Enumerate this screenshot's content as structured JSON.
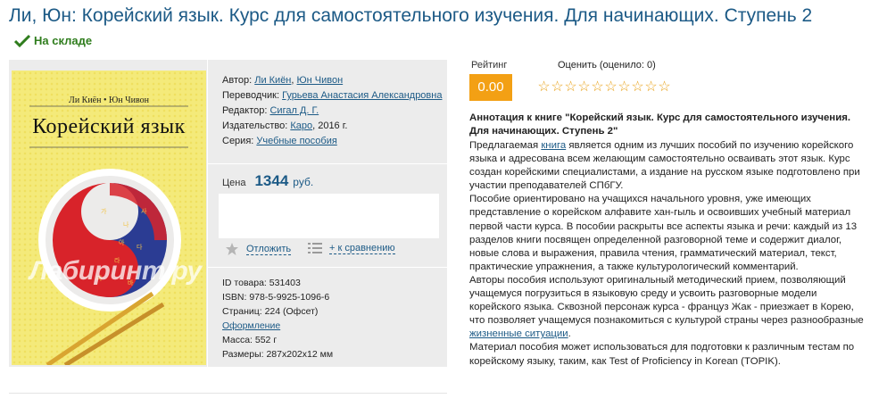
{
  "title": "Ли, Юн: Корейский язык. Курс для самостоятельного изучения. Для начинающих. Ступень 2",
  "stock_label": "На складе",
  "cover": {
    "authors": "Ли Киён • Юн Чивон",
    "title": "Корейский язык",
    "watermark": "Лабиринт.ру"
  },
  "meta": {
    "author_label": "Автор:",
    "author1": "Ли Киён",
    "author2": "Юн Чивон",
    "translator_label": "Переводчик:",
    "translator": "Гурьева Анастасия Александровна",
    "editor_label": "Редактор:",
    "editor": "Сигал Д. Г.",
    "publisher_label": "Издательство:",
    "publisher": "Каро",
    "year": ", 2016 г.",
    "series_label": "Серия:",
    "series": "Учебные пособия"
  },
  "price": {
    "label": "Цена",
    "value": "1344",
    "currency": "руб."
  },
  "actions": {
    "postpone": "Отложить",
    "compare": "+ к сравнению"
  },
  "details": {
    "id": "ID товара: 531403",
    "isbn": "ISBN: 978-5-9925-1096-6",
    "pages": "Страниц: 224 (Офсет)",
    "design": "Оформление",
    "weight": "Масса: 552 г",
    "size": "Размеры: 287x202x12 мм"
  },
  "rating": {
    "label": "Рейтинг",
    "value": "0.00",
    "rate_label": "Оценить (оценило: 0)",
    "stars": 10,
    "star_color": "#e8a21a",
    "badge_color": "#f3a014"
  },
  "annotation": {
    "heading": "Аннотация к книге \"Корейский язык. Курс для самостоятельного изучения. Для начинающих. Ступень 2\"",
    "p1_before": "Предлагаемая ",
    "p1_link": "книга",
    "p1_after": " является одним из лучших пособий по изучению корейского языка и адресована всем желающим самостоятельно осваивать этот язык. Курс создан корейскими специалистами, а издание на русском языке подготовлено при участии преподавателей СПбГУ.",
    "p2": "Пособие ориентировано на учащихся начального уровня, уже имеющих представление о корейском алфавите хан-гыль и освоивших учебный материал первой части курса. В пособии раскрыты все аспекты языка и речи: каждый из 13 разделов книги посвящен определенной разговорной теме и содержит диалог, новые слова и выражения, правила чтения, грамматический материал, текст, практические упражнения, а также культурологический комментарий.",
    "p3_before": "Авторы пособия используют оригинальный методический прием, позволяющий учащемуся погрузиться в языковую среду и усвоить разговорные модели корейского языка. Сквозной персонаж курса - француз Жак - приезжает в Корею, что позволяет учащемуся познакомиться с культурой страны через разнообразные ",
    "p3_link": "жизненные ситуации",
    "p3_after": ".",
    "p4": "Материал пособия может использоваться для подготовки к различным тестам по корейскому языку, таким, как Test of Proficiency in Korean (TOPIK)."
  },
  "colors": {
    "link": "#1c5a86",
    "stock": "#2f7d1d",
    "panel": "#ececec"
  }
}
